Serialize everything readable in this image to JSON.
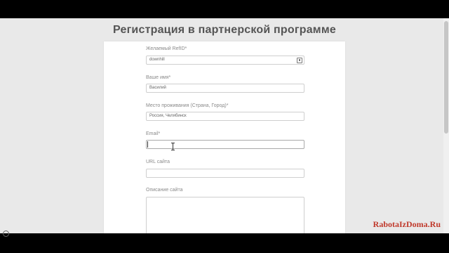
{
  "page": {
    "title": "Регистрация в партнерской программе"
  },
  "form": {
    "refid": {
      "label": "Желаемый RefID*",
      "value": "downhill"
    },
    "name": {
      "label": "Ваше имя*",
      "value": "Василий"
    },
    "location": {
      "label": "Место проживания (Страна, Город)*",
      "value": "Россия, Челябинск"
    },
    "email": {
      "label": "Email*",
      "value": ""
    },
    "url": {
      "label": "URL сайта",
      "value": ""
    },
    "description": {
      "label": "Описание сайта",
      "value": ""
    }
  },
  "watermark": {
    "text": "RabotaIzDoma.Ru"
  },
  "icons": {
    "refid_field_icon": "field-lock-icon",
    "mouse_cursor": "ibeam-cursor-icon"
  },
  "colors": {
    "watermark": "#c0392b",
    "background": "#e9e9e9",
    "card": "#ffffff"
  }
}
